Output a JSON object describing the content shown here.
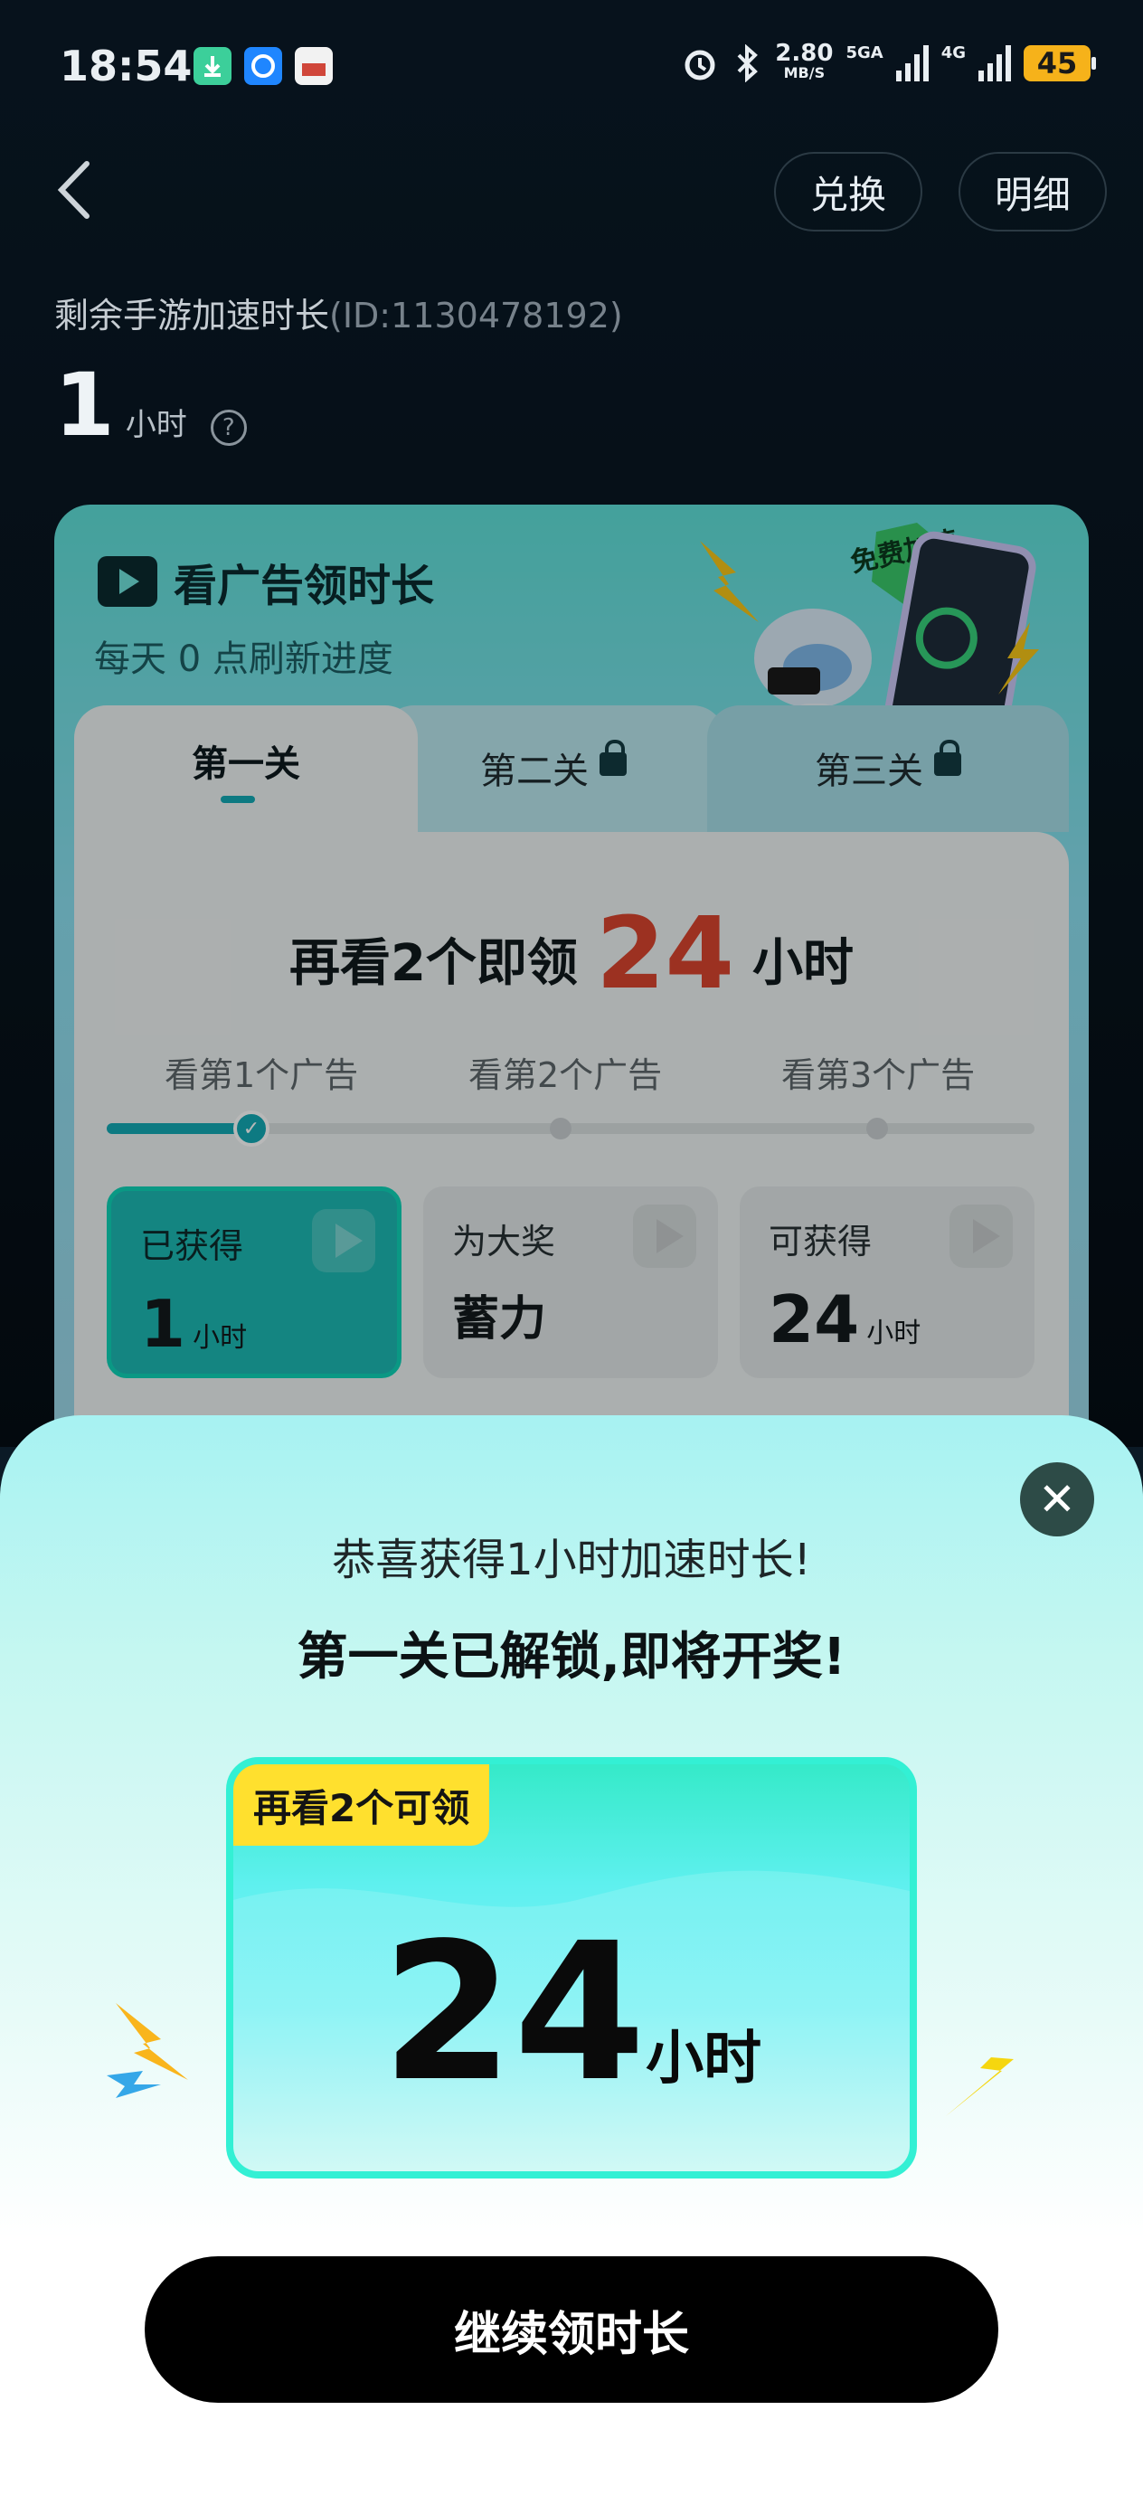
{
  "status_bar": {
    "time": "18:54",
    "net_speed": "2.80",
    "net_unit": "MB/S",
    "net_type1": "5GA",
    "net_type2": "4G",
    "battery": "45"
  },
  "header": {
    "exchange_label": "兑换",
    "detail_label": "明细"
  },
  "account": {
    "label": "剩余手游加速时长",
    "id_text": "(ID:1130478192)",
    "hours_value": "1",
    "hours_unit": "小时",
    "help_symbol": "?"
  },
  "card": {
    "title": "看广告领时长",
    "subtitle": "每天 0 点刷新进度",
    "badge": "免费加速",
    "tabs": [
      {
        "label": "第一关"
      },
      {
        "label": "第二关"
      },
      {
        "label": "第三关"
      }
    ],
    "headline_prefix": "再看2个即领",
    "headline_value": "24",
    "headline_unit": "小时",
    "steps": [
      "看第1个广告",
      "看第2个广告",
      "看第3个广告"
    ],
    "progress_fraction": 0.17,
    "boxes": [
      {
        "label": "已获得",
        "value": "1",
        "unit": "小时"
      },
      {
        "label": "为大奖",
        "value": "蓄力"
      },
      {
        "label": "可获得",
        "value": "24",
        "unit": "小时"
      }
    ]
  },
  "popup": {
    "congrats": "恭喜获得1小时加速时长!",
    "unlocked": "第一关已解锁,即将开奖!",
    "tag": "再看2个可领",
    "prize_value": "24",
    "prize_unit": "小时",
    "cta_label": "继续领时长"
  },
  "colors": {
    "accent": "#13a9b4",
    "highlight": "#d8442e",
    "tag": "#ffe02e",
    "cta": "#000000"
  }
}
